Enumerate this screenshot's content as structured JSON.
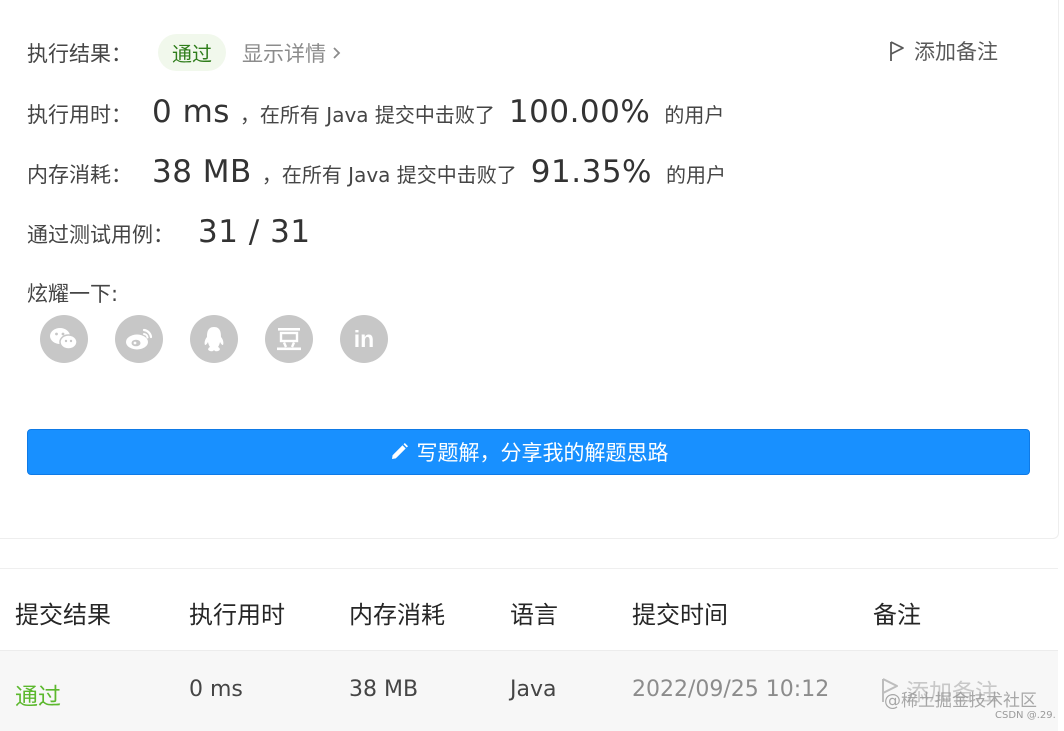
{
  "result": {
    "label": "执行结果：",
    "status": "通过",
    "details_link": "显示详情",
    "add_note": "添加备注"
  },
  "runtime": {
    "label": "执行用时：",
    "value": "0 ms",
    "mid_text": "，在所有 Java 提交中击败了",
    "percent": "100.00%",
    "suffix": "的用户"
  },
  "memory": {
    "label": "内存消耗：",
    "value": "38 MB",
    "mid_text": "，在所有 Java 提交中击败了",
    "percent": "91.35%",
    "suffix": "的用户"
  },
  "tests": {
    "label": "通过测试用例：",
    "value": "31 / 31"
  },
  "share": {
    "label": "炫耀一下:",
    "icons": [
      "wechat-icon",
      "weibo-icon",
      "qq-icon",
      "douban-icon",
      "linkedin-icon"
    ]
  },
  "write_solution_button": "写题解，分享我的解题思路",
  "table": {
    "headers": [
      "提交结果",
      "执行用时",
      "内存消耗",
      "语言",
      "提交时间",
      "备注"
    ],
    "row": {
      "status": "通过",
      "runtime": "0 ms",
      "memory": "38 MB",
      "language": "Java",
      "time": "2022/09/25 10:12",
      "note": "添加备注"
    }
  },
  "watermark": "@稀土掘金技术社区",
  "watermark_small": "CSDN @.29.",
  "colors": {
    "primary": "#1890ff",
    "pass": "#5cb82e",
    "icon_gray": "#c7c7c7"
  }
}
